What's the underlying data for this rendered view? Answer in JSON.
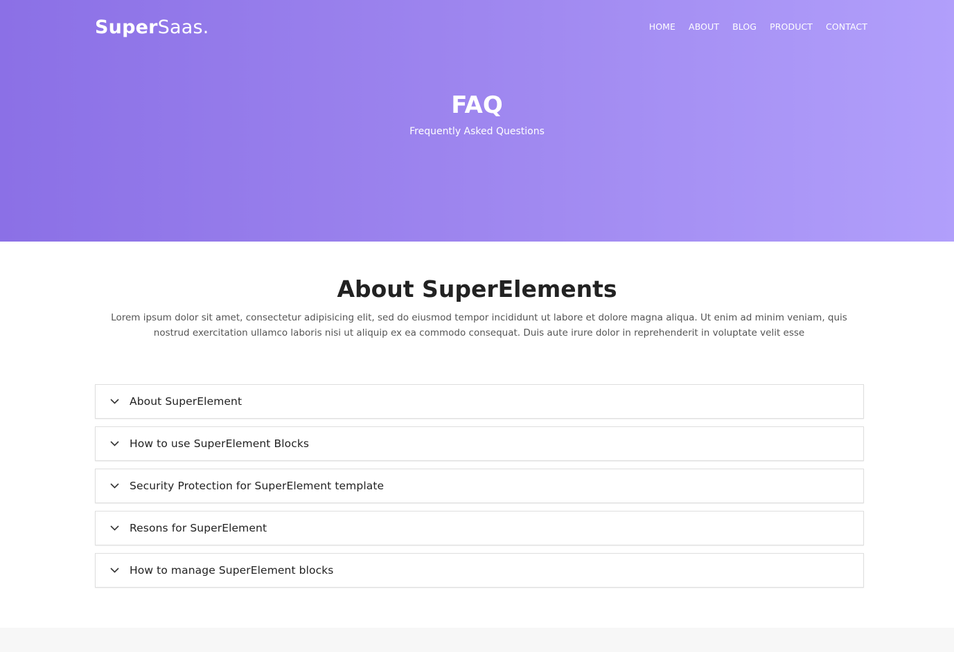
{
  "header": {
    "logo_bold": "Super",
    "logo_light": "Saas.",
    "nav": [
      "HOME",
      "ABOUT",
      "BLOG",
      "PRODUCT",
      "CONTACT"
    ]
  },
  "hero": {
    "title": "FAQ",
    "subtitle": "Frequently Asked Questions"
  },
  "section": {
    "title": "About SuperElements",
    "description": "Lorem ipsum dolor sit amet, consectetur adipisicing elit, sed do eiusmod tempor incididunt ut labore et dolore magna aliqua. Ut enim ad minim veniam, quis nostrud exercitation ullamco laboris nisi ut aliquip ex ea commodo consequat. Duis aute irure dolor in reprehenderit in voluptate velit esse"
  },
  "faq": [
    {
      "label": "About SuperElement",
      "icon": "chevron-down-icon"
    },
    {
      "label": "How to use SuperElement Blocks",
      "icon": "chevron-down-icon"
    },
    {
      "label": "Security Protection for SuperElement template",
      "icon": "chevron-down-icon"
    },
    {
      "label": "Resons for SuperElement",
      "icon": "chevron-down-icon"
    },
    {
      "label": "How to manage SuperElement blocks",
      "icon": "chevron-down-icon"
    }
  ],
  "colors": {
    "hero_start": "#8b70e6",
    "hero_end": "#b19ffb",
    "text_dark": "#222222"
  }
}
